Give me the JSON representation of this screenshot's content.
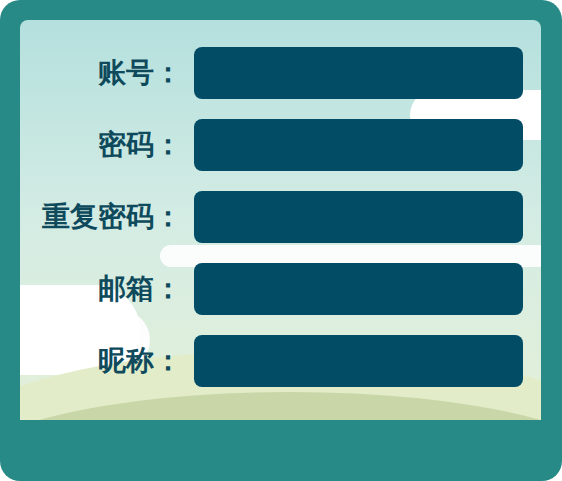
{
  "form": {
    "fields": [
      {
        "label": "账号："
      },
      {
        "label": "密码："
      },
      {
        "label": "重复密码："
      },
      {
        "label": "邮箱："
      },
      {
        "label": "昵称："
      }
    ]
  }
}
